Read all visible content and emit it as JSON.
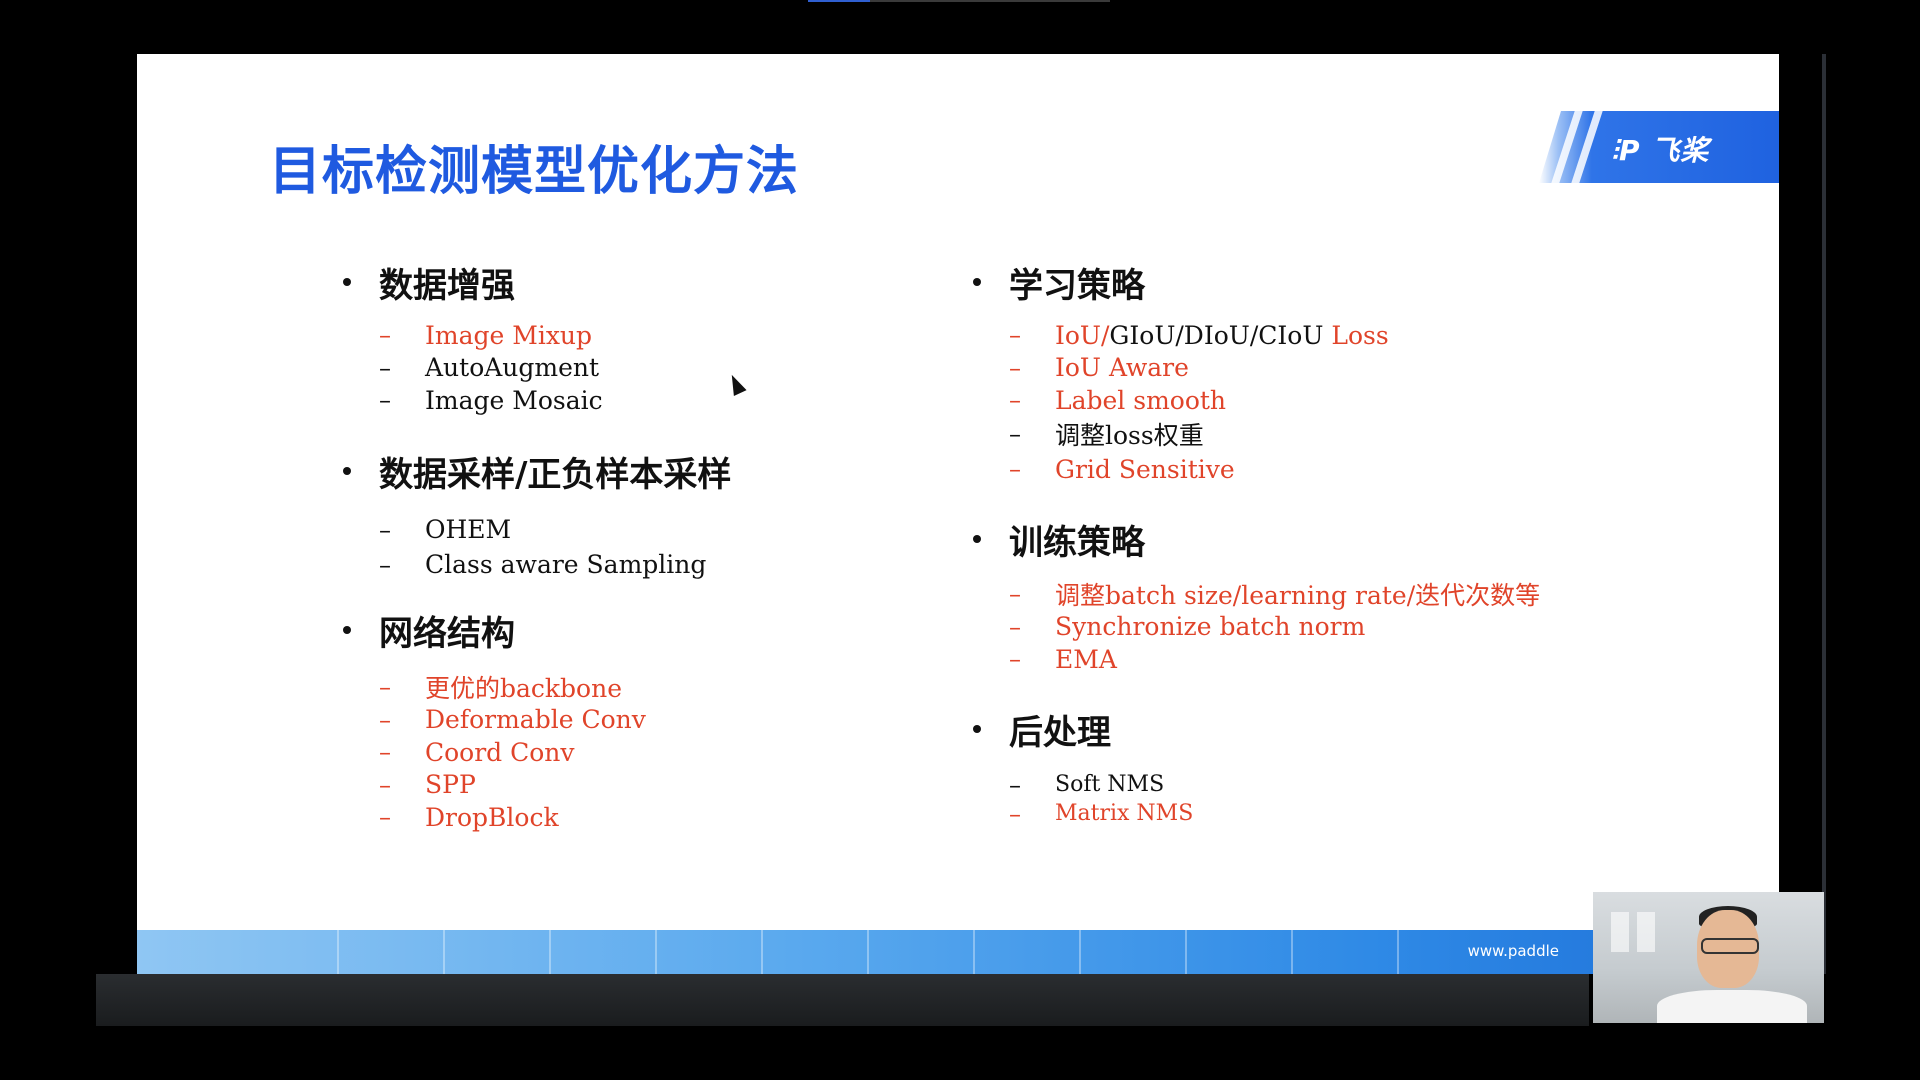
{
  "slide": {
    "title": "目标检测模型优化方法",
    "logo_text": "飞桨",
    "website": "www.paddle"
  },
  "colors": {
    "accent": "#1f5ae0",
    "red": "#e0442a",
    "black": "#111111"
  },
  "left_sections": [
    {
      "heading": "数据增强",
      "items": [
        {
          "text": "Image Mixup",
          "color": "red"
        },
        {
          "text": "AutoAugment",
          "color": "black"
        },
        {
          "text": "Image Mosaic",
          "color": "black"
        }
      ]
    },
    {
      "heading": "数据采样/正负样本采样",
      "items": [
        {
          "text": "OHEM",
          "color": "black"
        },
        {
          "text": "Class aware Sampling",
          "color": "black"
        }
      ]
    },
    {
      "heading": "网络结构",
      "items": [
        {
          "text": "更优的backbone",
          "color": "red"
        },
        {
          "text": "Deformable Conv",
          "color": "red"
        },
        {
          "text": "Coord Conv",
          "color": "red"
        },
        {
          "text": "SPP",
          "color": "red"
        },
        {
          "text": "DropBlock",
          "color": "red"
        }
      ]
    }
  ],
  "right_sections": [
    {
      "heading": "学习策略",
      "items": [
        {
          "parts": [
            {
              "text": "IoU/",
              "color": "red"
            },
            {
              "text": "GIoU/DIoU/CIoU",
              "color": "black"
            },
            {
              "text": " Loss",
              "color": "red"
            }
          ]
        },
        {
          "text": "IoU Aware",
          "color": "red"
        },
        {
          "text": "Label smooth",
          "color": "red"
        },
        {
          "text": "调整loss权重",
          "color": "black"
        },
        {
          "text": "Grid Sensitive",
          "color": "red"
        }
      ]
    },
    {
      "heading": "训练策略",
      "items": [
        {
          "text": "调整batch size/learning rate/迭代次数等",
          "color": "red"
        },
        {
          "text": "Synchronize batch norm",
          "color": "red"
        },
        {
          "text": "EMA",
          "color": "red"
        }
      ]
    },
    {
      "heading": "后处理",
      "items": [
        {
          "text": "Soft NMS",
          "color": "black"
        },
        {
          "text": "Matrix NMS",
          "color": "red"
        }
      ]
    }
  ]
}
